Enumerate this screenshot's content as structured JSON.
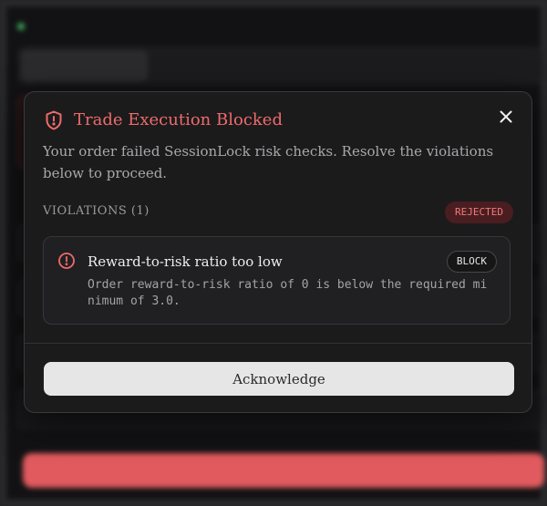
{
  "modal": {
    "title": "Trade Execution Blocked",
    "description": "Your order failed SessionLock risk checks. Resolve the violations below to proceed.",
    "violations_label": "VIOLATIONS (1)",
    "status_badge": "REJECTED",
    "violations": [
      {
        "title": "Reward-to-risk ratio too low",
        "severity": "BLOCK",
        "detail": "Order reward-to-risk ratio of 0 is below the required minimum of 3.0."
      }
    ],
    "acknowledge_label": "Acknowledge",
    "icons": {
      "header": "shield-alert-icon",
      "violation": "alert-circle-icon",
      "close": "close-icon"
    }
  },
  "colors": {
    "danger": "#ef6a6a",
    "danger_bg": "#4a1d21",
    "modal_bg": "#1b1b1c",
    "button_bg": "#e6e6e6"
  }
}
